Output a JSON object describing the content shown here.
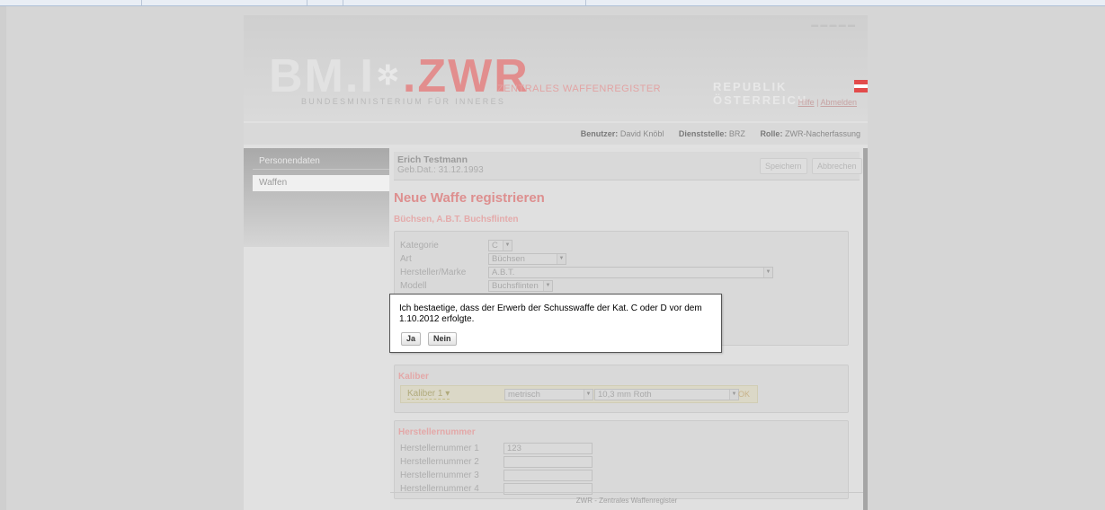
{
  "header": {
    "logo_left": "BM.I",
    "logo_right": ".ZWR",
    "zwr_subtitle": "ZENTRALES WAFFENREGISTER",
    "ministry": "BUNDESMINISTERIUM FÜR INNERES",
    "republik": "REPUBLIK ÖSTERREICH",
    "link_hilfe": "Hilfe",
    "link_separator": "|",
    "link_abmelden": "Abmelden"
  },
  "userbar": {
    "benutzer_label": "Benutzer:",
    "benutzer_value": "David Knöbl",
    "dienststelle_label": "Dienststelle:",
    "dienststelle_value": "BRZ",
    "rolle_label": "Rolle:",
    "rolle_value": "ZWR-Nacherfassung"
  },
  "sidebar": {
    "items": [
      {
        "label": "Personendaten"
      },
      {
        "label": "Waffen"
      }
    ]
  },
  "person": {
    "name": "Erich Testmann",
    "dob": "Geb.Dat.: 31.12.1993",
    "save_label": "Speichern",
    "cancel_label": "Abbrechen"
  },
  "main": {
    "title": "Neue Waffe registrieren",
    "subtitle": "Büchsen, A.B.T. Buchsflinten"
  },
  "weapon_form": {
    "kategorie_label": "Kategorie",
    "kategorie_value": "C",
    "art_label": "Art",
    "art_value": "Büchsen",
    "hersteller_label": "Hersteller/Marke",
    "hersteller_value": "A.B.T.",
    "modell_label": "Modell",
    "modell_value": "Buchsflinten"
  },
  "kaliber": {
    "title": "Kaliber",
    "row_label": "Kaliber 1 ▾",
    "system_value": "metrisch",
    "caliber_value": "10,3 mm Roth",
    "ok_label": "OK"
  },
  "herstellernummer": {
    "title": "Herstellernummer",
    "rows": [
      {
        "label": "Herstellernummer 1",
        "value": "123"
      },
      {
        "label": "Herstellernummer 2",
        "value": ""
      },
      {
        "label": "Herstellernummer 3",
        "value": ""
      },
      {
        "label": "Herstellernummer 4",
        "value": ""
      }
    ]
  },
  "footer": {
    "text": "ZWR - Zentrales Waffenregister"
  },
  "dialog": {
    "message": "Ich bestaetige, dass der Erwerb der Schusswaffe der Kat. C oder D vor dem 1.10.2012 erfolgte.",
    "yes_label": "Ja",
    "no_label": "Nein"
  },
  "colors": {
    "accent": "#dd8f8f",
    "flag_red": "#e24b4b",
    "flag_white": "#ffffff"
  }
}
